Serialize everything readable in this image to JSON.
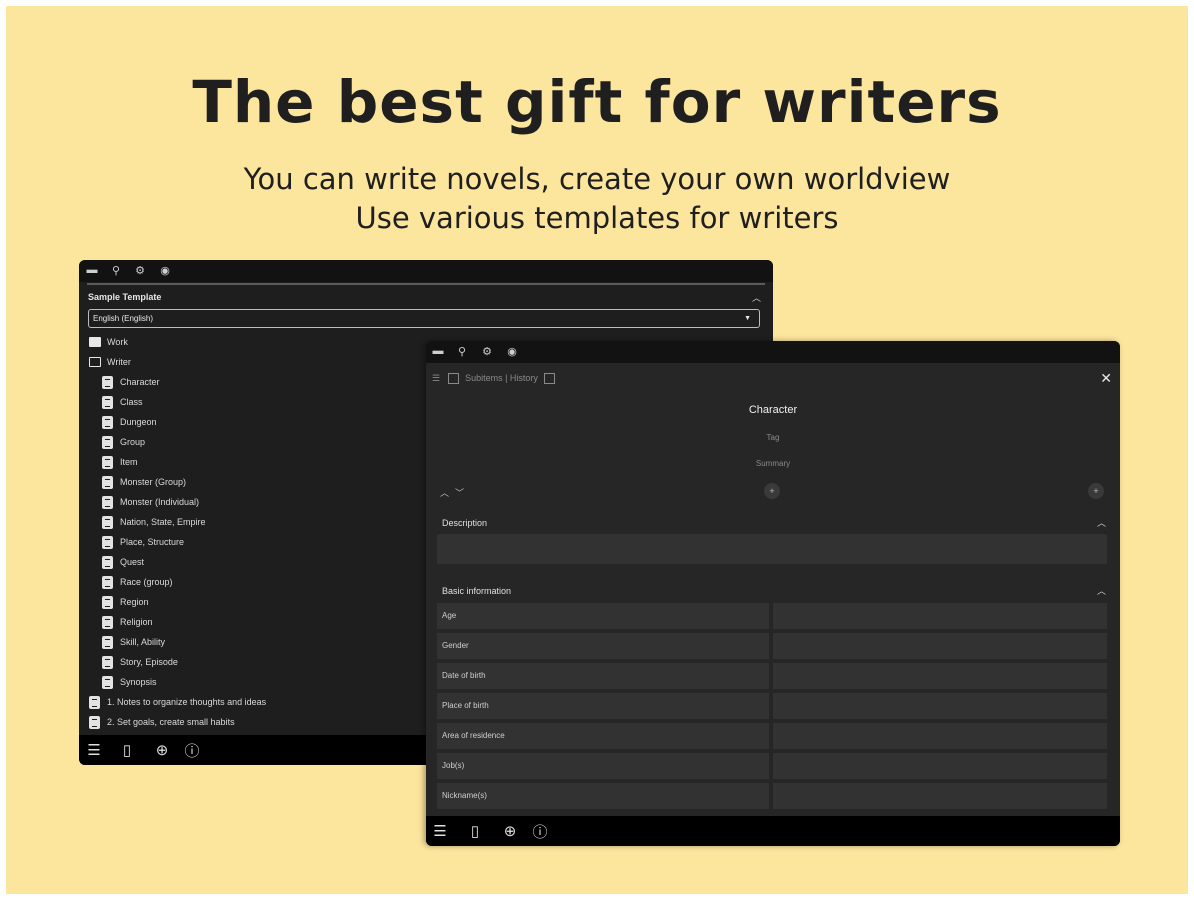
{
  "headline": "The best gift for writers",
  "subline_1": "You can write novels, create your own worldview",
  "subline_2": "Use various templates for writers",
  "left_window": {
    "template_label": "Sample Template",
    "language": "English (English)",
    "folders": [
      {
        "label": "Work",
        "icon": "folder-icon"
      },
      {
        "label": "Writer",
        "icon": "folder-open-icon"
      }
    ],
    "docs": [
      "Character",
      "Class",
      "Dungeon",
      "Group",
      "Item",
      "Monster (Group)",
      "Monster (Individual)",
      "Nation, State, Empire",
      "Place, Structure",
      "Quest",
      "Race (group)",
      "Region",
      "Religion",
      "Skill, Ability",
      "Story, Episode",
      "Synopsis"
    ],
    "notes": [
      "1. Notes to organize thoughts and ideas",
      "2. Set goals, create small habits"
    ]
  },
  "right_window": {
    "toolbar_text": "Subitems | History",
    "doc_title": "Character",
    "tag_placeholder": "Tag",
    "summary_placeholder": "Summary",
    "description_label": "Description",
    "basic_info_label": "Basic information",
    "fields": [
      "Age",
      "Gender",
      "Date of birth",
      "Place of birth",
      "Area of residence",
      "Job(s)",
      "Nickname(s)"
    ]
  },
  "icons": [
    "folder-icon",
    "search-icon",
    "gear-icon",
    "account-icon",
    "menu-icon",
    "phone-icon",
    "globe-icon",
    "help-icon"
  ]
}
